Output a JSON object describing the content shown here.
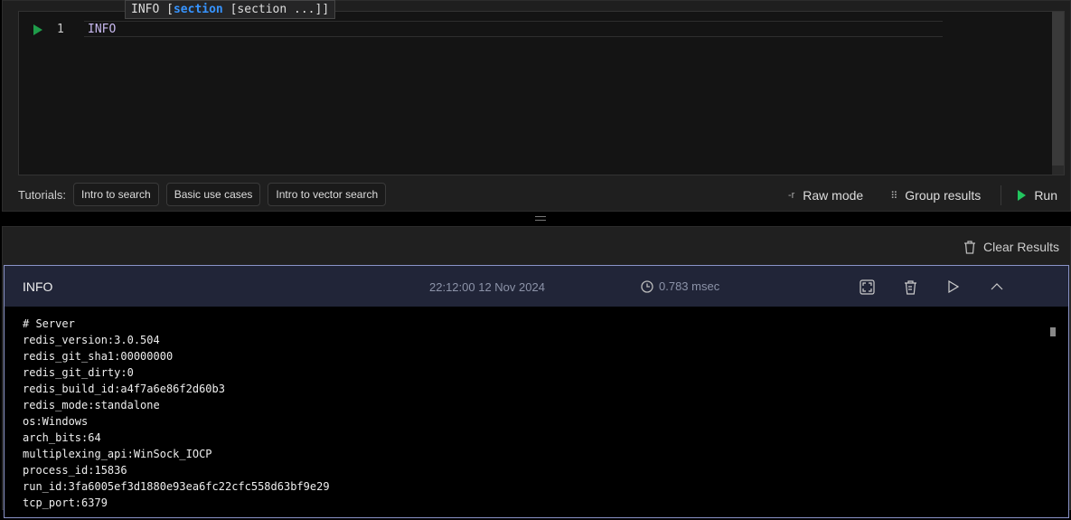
{
  "editor": {
    "line_number": "1",
    "code": "INFO",
    "tooltip": {
      "cmd": "INFO ",
      "open": "[",
      "param": "section",
      "rest": " [section ...]]"
    }
  },
  "tutorials": {
    "label": "Tutorials:",
    "buttons": [
      "Intro to search",
      "Basic use cases",
      "Intro to vector search"
    ]
  },
  "toolbar": {
    "raw_prefix": "-r",
    "raw_mode": "Raw mode",
    "group_results": "Group results",
    "run": "Run"
  },
  "results": {
    "clear_label": "Clear Results",
    "card": {
      "command": "INFO",
      "timestamp": "22:12:00 12 Nov 2024",
      "duration": "0.783 msec",
      "output": [
        "# Server",
        "redis_version:3.0.504",
        "redis_git_sha1:00000000",
        "redis_git_dirty:0",
        "redis_build_id:a4f7a6e86f2d60b3",
        "redis_mode:standalone",
        "os:Windows",
        "arch_bits:64",
        "multiplexing_api:WinSock_IOCP",
        "process_id:15836",
        "run_id:3fa6005ef3d1880e93ea6fc22cfc558d63bf9e29",
        "tcp_port:6379"
      ]
    }
  }
}
